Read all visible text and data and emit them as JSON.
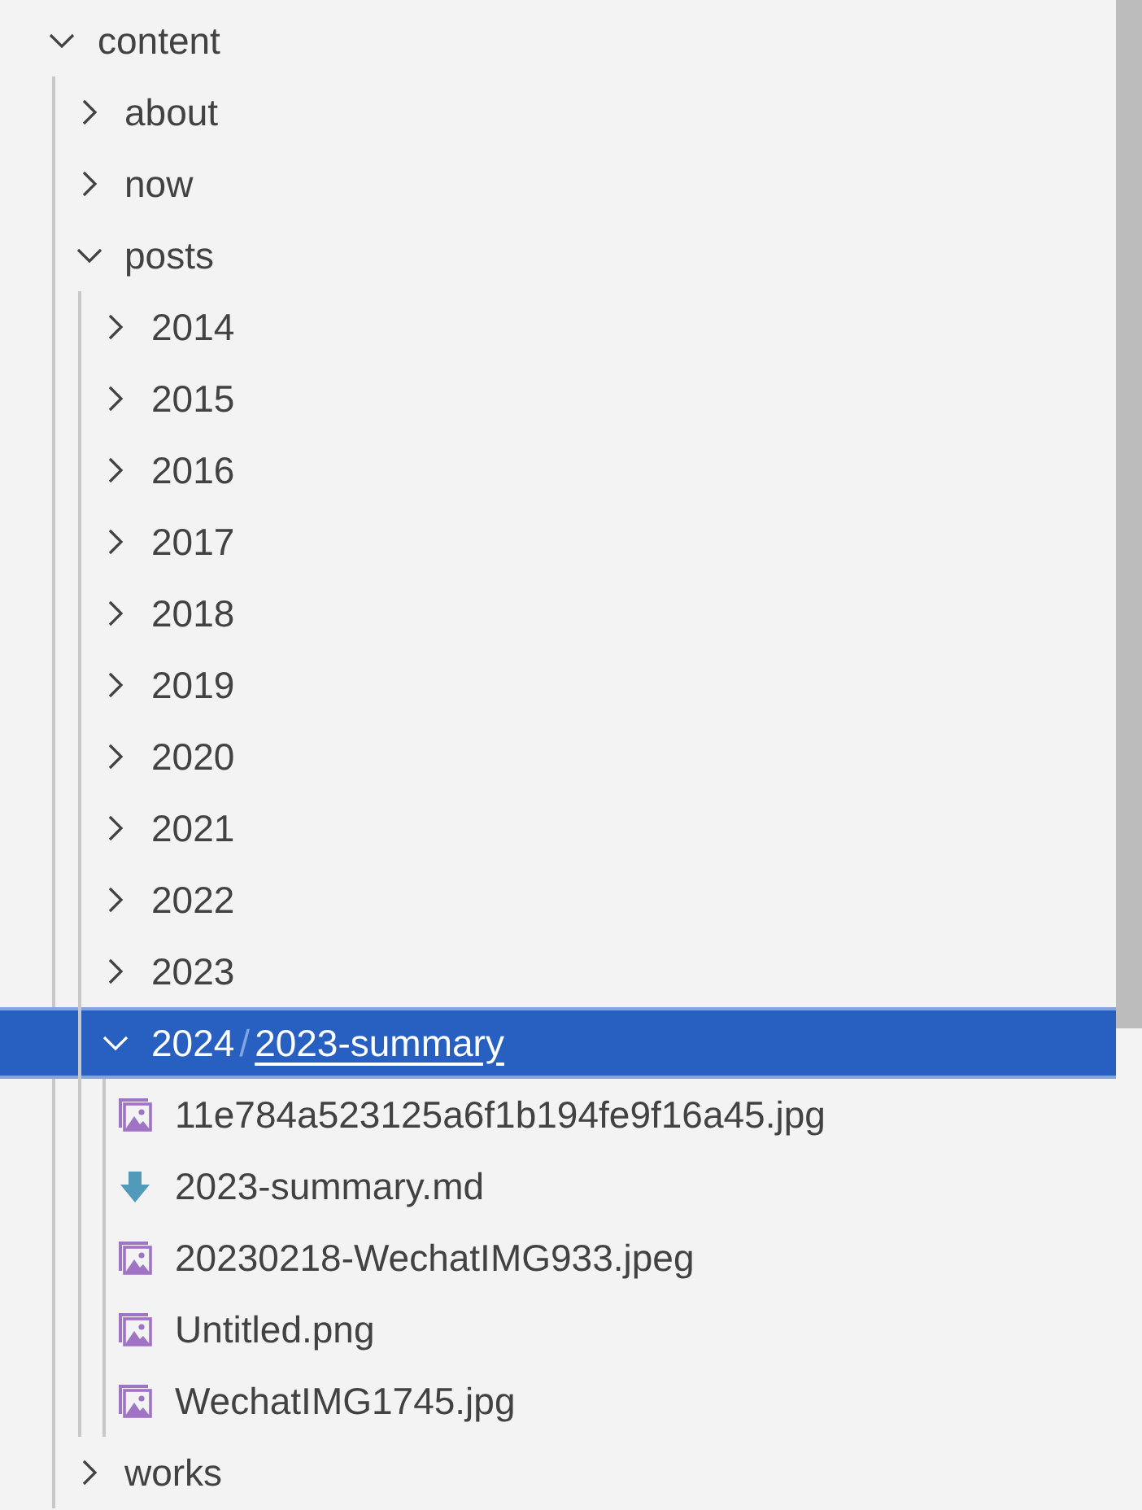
{
  "tree": [
    {
      "kind": "folder",
      "label": "content",
      "expanded": true,
      "selected": false,
      "children": [
        {
          "kind": "folder",
          "label": "about",
          "expanded": false,
          "selected": false
        },
        {
          "kind": "folder",
          "label": "now",
          "expanded": false,
          "selected": false
        },
        {
          "kind": "folder",
          "label": "posts",
          "expanded": true,
          "selected": false,
          "children": [
            {
              "kind": "folder",
              "label": "2014",
              "expanded": false,
              "selected": false
            },
            {
              "kind": "folder",
              "label": "2015",
              "expanded": false,
              "selected": false
            },
            {
              "kind": "folder",
              "label": "2016",
              "expanded": false,
              "selected": false
            },
            {
              "kind": "folder",
              "label": "2017",
              "expanded": false,
              "selected": false
            },
            {
              "kind": "folder",
              "label": "2018",
              "expanded": false,
              "selected": false
            },
            {
              "kind": "folder",
              "label": "2019",
              "expanded": false,
              "selected": false
            },
            {
              "kind": "folder",
              "label": "2020",
              "expanded": false,
              "selected": false
            },
            {
              "kind": "folder",
              "label": "2021",
              "expanded": false,
              "selected": false
            },
            {
              "kind": "folder",
              "label": "2022",
              "expanded": false,
              "selected": false
            },
            {
              "kind": "folder",
              "label": "2023",
              "expanded": false,
              "selected": false
            },
            {
              "kind": "folder",
              "label": "2024",
              "separator": "/",
              "compact": "2023-summary",
              "expanded": true,
              "selected": true,
              "children": [
                {
                  "kind": "image",
                  "label": "11e784a523125a6f1b194fe9f16a45.jpg",
                  "selected": false
                },
                {
                  "kind": "markdown",
                  "label": "2023-summary.md",
                  "selected": false
                },
                {
                  "kind": "image",
                  "label": "20230218-WechatIMG933.jpeg",
                  "selected": false
                },
                {
                  "kind": "image",
                  "label": "Untitled.png",
                  "selected": false
                },
                {
                  "kind": "image",
                  "label": "WechatIMG1745.jpg",
                  "selected": false
                }
              ]
            }
          ]
        },
        {
          "kind": "folder",
          "label": "works",
          "expanded": false,
          "selected": false
        }
      ]
    }
  ]
}
